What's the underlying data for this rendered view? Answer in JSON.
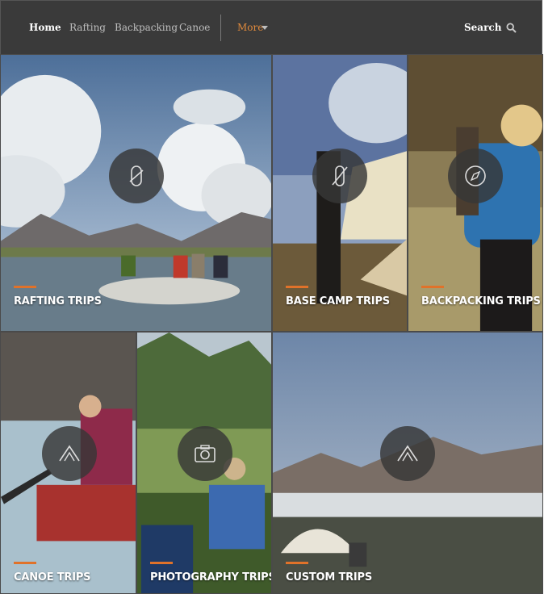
{
  "nav": {
    "items": [
      {
        "label": "Home"
      },
      {
        "label": "Rafting"
      },
      {
        "label": "Backpacking"
      },
      {
        "label": "Canoe"
      }
    ],
    "more_label": "More",
    "search_label": "Search"
  },
  "tiles": {
    "rafting": {
      "label": "RAFTING TRIPS",
      "icon": "carabiner-icon"
    },
    "base_camp": {
      "label": "BASE CAMP TRIPS",
      "icon": "tent-pole-icon"
    },
    "backpacking": {
      "label": "BACKPACKING TRIPS",
      "icon": "compass-icon"
    },
    "canoe": {
      "label": "CANOE TRIPS",
      "icon": "tent-icon"
    },
    "photography": {
      "label": "PHOTOGRAPHY TRIPS",
      "icon": "camera-icon"
    },
    "custom": {
      "label": "CUSTOM TRIPS",
      "icon": "tent-icon"
    }
  },
  "colors": {
    "accent": "#e0722a",
    "nav_bg": "#3a3a3a",
    "more_link": "#e08a3c"
  }
}
